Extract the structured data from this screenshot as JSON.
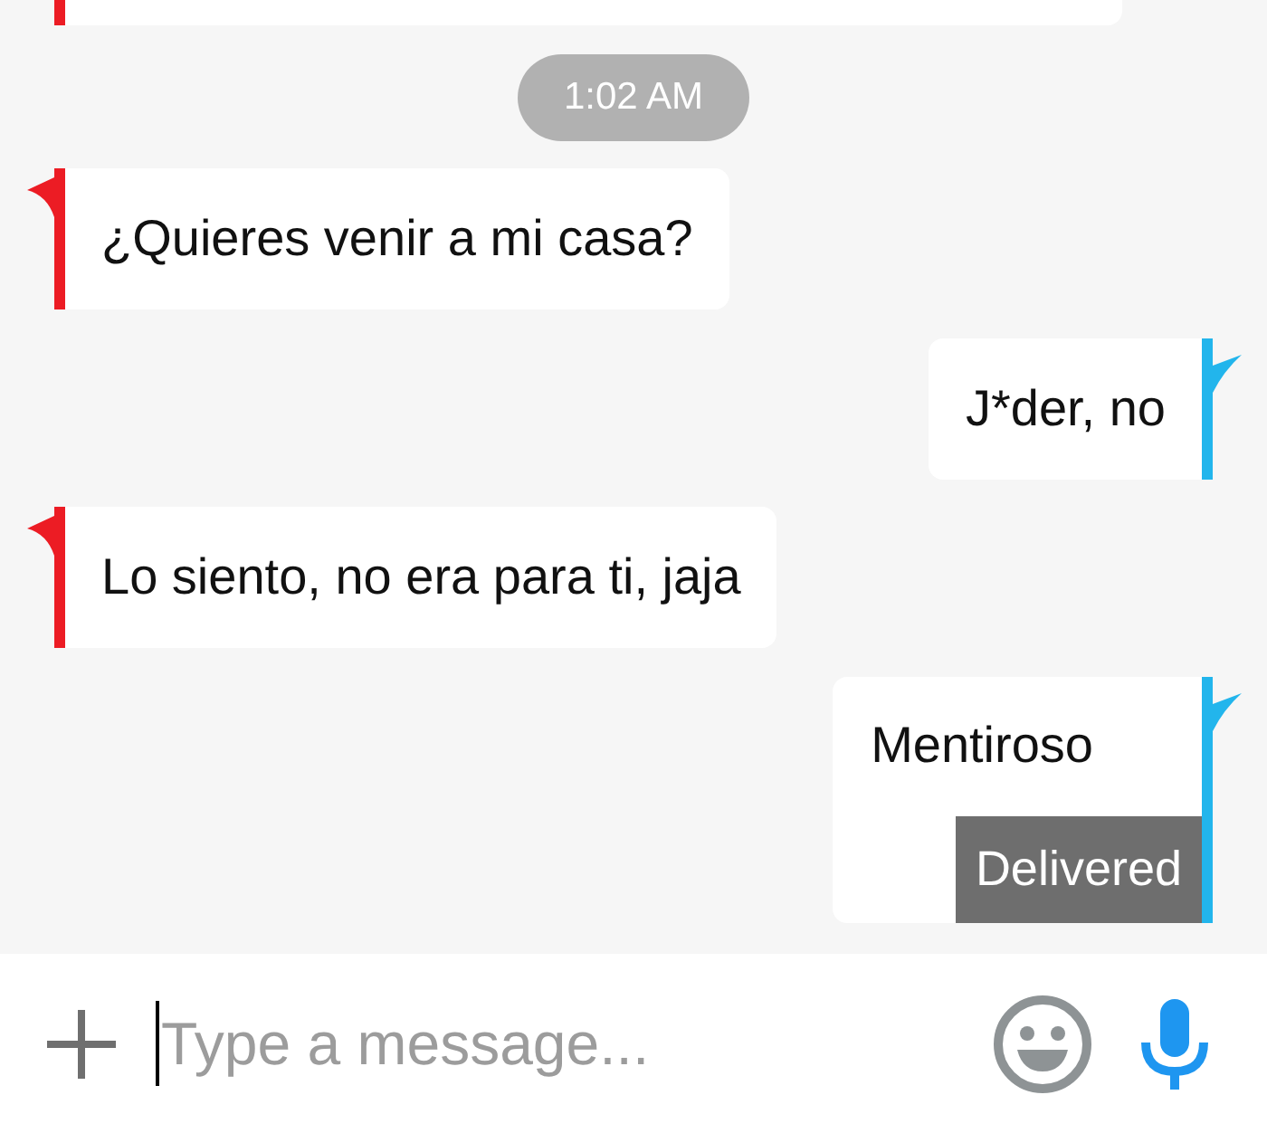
{
  "chat": [
    {
      "kind": "incoming",
      "cut_off": true,
      "color": "#ec1c24"
    },
    {
      "kind": "time",
      "text": "1:02 AM"
    },
    {
      "kind": "incoming",
      "cut_off": false,
      "color": "#ec1c24",
      "text": "¿Quieres venir a mi casa?"
    },
    {
      "kind": "outgoing",
      "cut_off": false,
      "color": "#22b5ec",
      "text": "J*der, no"
    },
    {
      "kind": "incoming",
      "cut_off": false,
      "color": "#ec1c24",
      "text": "Lo siento, no era para ti, jaja"
    },
    {
      "kind": "outgoing",
      "cut_off": false,
      "color": "#22b5ec",
      "text": "Mentiroso",
      "status": "Delivered"
    }
  ],
  "input_bar": {
    "placeholder": "Type a message..."
  }
}
